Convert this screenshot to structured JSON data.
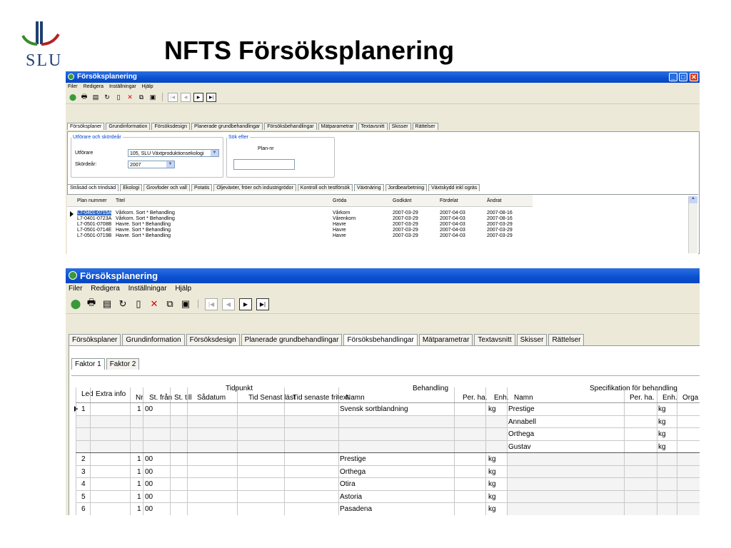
{
  "slide": {
    "title": "NFTS Försöksplanering",
    "logo_text": "SLU"
  },
  "app": {
    "title": "Försöksplanering",
    "menu": [
      "Filer",
      "Redigera",
      "Inställningar",
      "Hjälp"
    ]
  },
  "win1": {
    "tabs": [
      "Försöksplaner",
      "Grundinformation",
      "Försöksdesign",
      "Planerade grundbehandlingar",
      "Försöksbehandlingar",
      "Mätparametrar",
      "Textavsnitt",
      "Skisser",
      "Rättelser"
    ],
    "group_utforare": "Utförare och skördeår",
    "label_utforare": "Utförare",
    "value_utforare": "105, SLU Växtproduktionsekologi",
    "label_skordear": "Skördeår:",
    "value_skordear": "2007",
    "group_sok": "Sök efter",
    "label_plannr": "Plan-nr",
    "subtabs": [
      "Stråsäd och trindsäd",
      "Ekologi",
      "Grovfoder och vall",
      "Potatis",
      "Oljeväxter, fröer och industrigrödor",
      "Kontroll och testförsök",
      "Växtnäring",
      "Jordbearbetning",
      "Växtskydd inkl ogräs"
    ],
    "columns": [
      "Plan nummer",
      "Titel",
      "Gröda",
      "Godkänt",
      "Fördelat",
      "Ändrat"
    ],
    "rows": [
      [
        "L7-0401-0715A",
        "Vårkorn. Sort * Behandling",
        "Vårkorn",
        "2007-03-29",
        "2007-04-03",
        "2007-08-16"
      ],
      [
        "L7-0401-0723A",
        "Vårkorn. Sort * Behandling",
        "Vårenkorn",
        "2007-03-29",
        "2007-04-03",
        "2007-08-16"
      ],
      [
        "L7-0501-0708B",
        "Havre. Sort * Behandling",
        "Havre",
        "2007-03-29",
        "2007-04-03",
        "2007-03-29"
      ],
      [
        "L7-0501-0714E",
        "Havre. Sort * Behandling",
        "Havre",
        "2007-03-29",
        "2007-04-03",
        "2007-03-29"
      ],
      [
        "L7-0501-0719B",
        "Havre. Sort * Behandling",
        "Havre",
        "2007-03-29",
        "2007-04-03",
        "2007-03-29"
      ]
    ]
  },
  "win2": {
    "tabs": [
      "Försöksplaner",
      "Grundinformation",
      "Försöksdesign",
      "Planerade grundbehandlingar",
      "Försöksbehandlingar",
      "Mätparametrar",
      "Textavsnitt",
      "Skisser",
      "Rättelser"
    ],
    "factor_tabs": [
      "Faktor 1",
      "Faktor 2"
    ],
    "group_headers": {
      "tidpunkt": "Tidpunkt",
      "behandling": "Behandling",
      "spec": "Specifikation för behandling"
    },
    "columns": {
      "led": "Led",
      "extra": "Extra info",
      "nr": "Nr",
      "st_fran": "St. från",
      "st_till": "St. till",
      "sadatum": "Sådatum",
      "tid_senast": "Tid Senast läst",
      "tid_fritext": "Tid senaste fritext",
      "namn": "Namn",
      "per_ha": "Per. ha.",
      "enh": "Enh.",
      "spec_namn": "Namn",
      "spec_per_ha": "Per. ha.",
      "spec_enh": "Enh.",
      "spec_org": "Orga"
    },
    "rows": [
      {
        "led": "1",
        "nr": "1",
        "st_fran": "00",
        "namn": "Svensk sortblandning",
        "enh": "kg",
        "spec_namn": "Prestige",
        "spec_enh": "kg"
      },
      {
        "led": "",
        "nr": "",
        "st_fran": "",
        "namn": "",
        "enh": "",
        "spec_namn": "Annabell",
        "spec_enh": "kg"
      },
      {
        "led": "",
        "nr": "",
        "st_fran": "",
        "namn": "",
        "enh": "",
        "spec_namn": "Orthega",
        "spec_enh": "kg"
      },
      {
        "led": "",
        "nr": "",
        "st_fran": "",
        "namn": "",
        "enh": "",
        "spec_namn": "Gustav",
        "spec_enh": "kg"
      },
      {
        "led": "2",
        "nr": "1",
        "st_fran": "00",
        "namn": "Prestige",
        "enh": "kg",
        "spec_namn": "",
        "spec_enh": ""
      },
      {
        "led": "3",
        "nr": "1",
        "st_fran": "00",
        "namn": "Orthega",
        "enh": "kg",
        "spec_namn": "",
        "spec_enh": ""
      },
      {
        "led": "4",
        "nr": "1",
        "st_fran": "00",
        "namn": "Otira",
        "enh": "kg",
        "spec_namn": "",
        "spec_enh": ""
      },
      {
        "led": "5",
        "nr": "1",
        "st_fran": "00",
        "namn": "Astoria",
        "enh": "kg",
        "spec_namn": "",
        "spec_enh": ""
      },
      {
        "led": "6",
        "nr": "1",
        "st_fran": "00",
        "namn": "Pasadena",
        "enh": "kg",
        "spec_namn": "",
        "spec_enh": ""
      }
    ]
  },
  "colors": {
    "titlebar": "#0a4fd0",
    "logo_green": "#3a8a2a",
    "logo_red": "#b22222",
    "logo_blue": "#1f3f73"
  }
}
